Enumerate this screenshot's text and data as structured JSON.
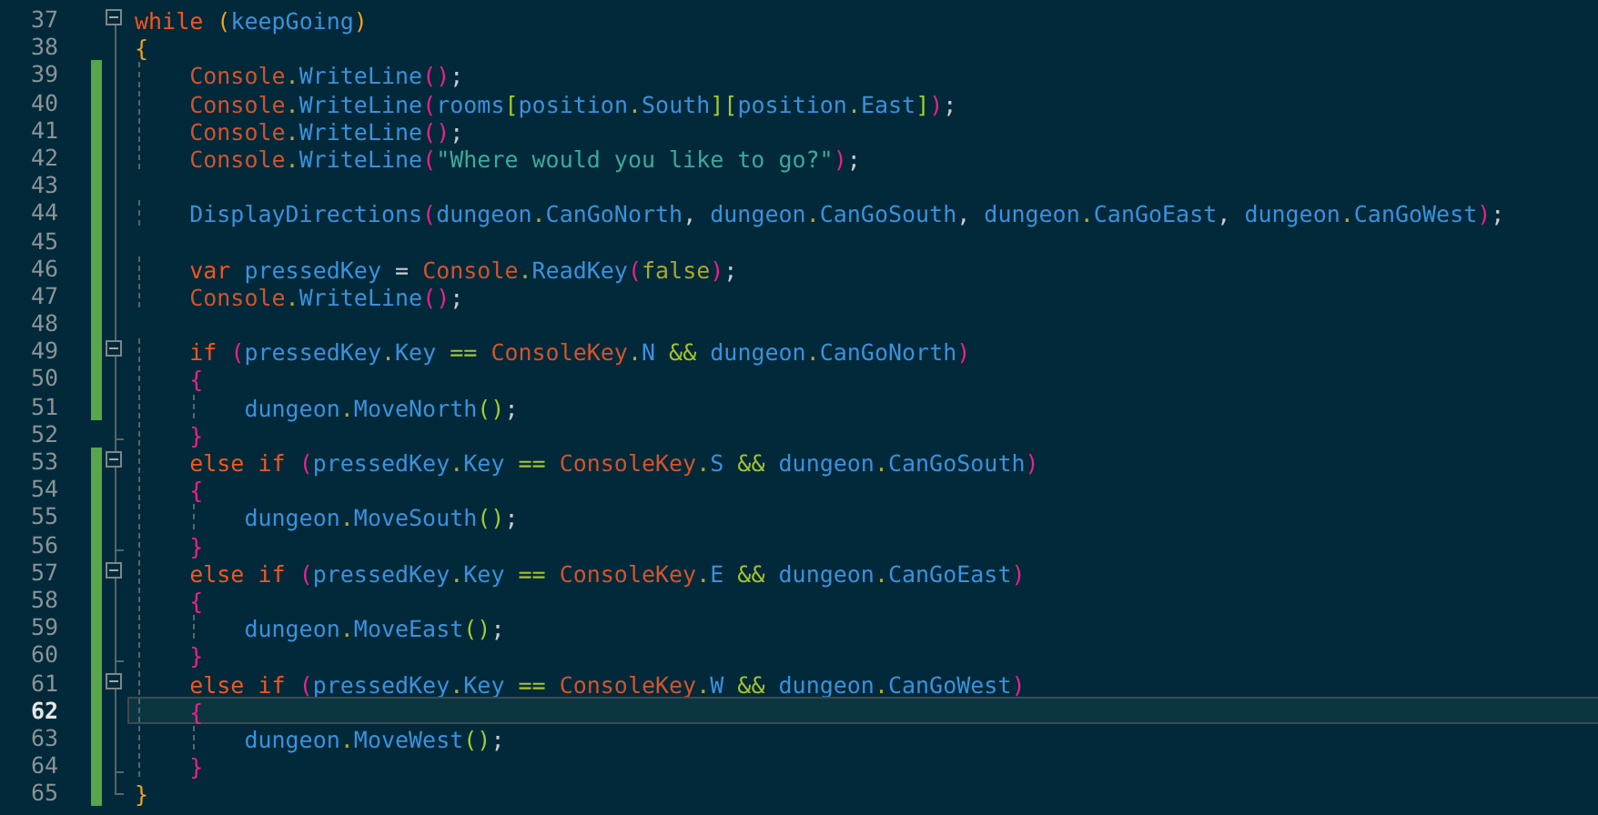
{
  "editor": {
    "lines": [
      {
        "number": "37",
        "changed": false,
        "current": false,
        "collapsible": true,
        "block_end": false,
        "tokens": [
          {
            "kind": "keyword",
            "text": "while "
          },
          {
            "kind": "brace-outer",
            "text": "("
          },
          {
            "kind": "name",
            "text": "keepGoing"
          },
          {
            "kind": "brace-outer",
            "text": ")"
          }
        ]
      },
      {
        "number": "38",
        "changed": false,
        "current": false,
        "collapsible": false,
        "block_end": false,
        "tokens": [
          {
            "kind": "brace-outer",
            "text": "{"
          }
        ]
      },
      {
        "number": "39",
        "changed": true,
        "current": false,
        "collapsible": false,
        "block_end": false,
        "tokens": [
          {
            "kind": "type",
            "text": "    Console"
          },
          {
            "kind": "dot",
            "text": "."
          },
          {
            "kind": "name",
            "text": "WriteLine"
          },
          {
            "kind": "brace-inner",
            "text": "()"
          },
          {
            "kind": "punct",
            "text": ";"
          }
        ]
      },
      {
        "number": "40",
        "changed": true,
        "current": false,
        "collapsible": false,
        "block_end": false,
        "tokens": [
          {
            "kind": "type",
            "text": "    Console"
          },
          {
            "kind": "dot",
            "text": "."
          },
          {
            "kind": "name",
            "text": "WriteLine"
          },
          {
            "kind": "brace-inner",
            "text": "("
          },
          {
            "kind": "name",
            "text": "rooms"
          },
          {
            "kind": "brace-nested",
            "text": "["
          },
          {
            "kind": "name",
            "text": "position"
          },
          {
            "kind": "dot",
            "text": "."
          },
          {
            "kind": "name",
            "text": "South"
          },
          {
            "kind": "brace-nested",
            "text": "]["
          },
          {
            "kind": "name",
            "text": "position"
          },
          {
            "kind": "dot",
            "text": "."
          },
          {
            "kind": "name",
            "text": "East"
          },
          {
            "kind": "brace-nested",
            "text": "]"
          },
          {
            "kind": "brace-inner",
            "text": ")"
          },
          {
            "kind": "punct",
            "text": ";"
          }
        ]
      },
      {
        "number": "41",
        "changed": true,
        "current": false,
        "collapsible": false,
        "block_end": false,
        "tokens": [
          {
            "kind": "type",
            "text": "    Console"
          },
          {
            "kind": "dot",
            "text": "."
          },
          {
            "kind": "name",
            "text": "WriteLine"
          },
          {
            "kind": "brace-inner",
            "text": "()"
          },
          {
            "kind": "punct",
            "text": ";"
          }
        ]
      },
      {
        "number": "42",
        "changed": true,
        "current": false,
        "collapsible": false,
        "block_end": false,
        "tokens": [
          {
            "kind": "type",
            "text": "    Console"
          },
          {
            "kind": "dot",
            "text": "."
          },
          {
            "kind": "name",
            "text": "WriteLine"
          },
          {
            "kind": "brace-inner",
            "text": "("
          },
          {
            "kind": "string",
            "text": "\"Where would you like to go?\""
          },
          {
            "kind": "brace-inner",
            "text": ")"
          },
          {
            "kind": "punct",
            "text": ";"
          }
        ]
      },
      {
        "number": "43",
        "changed": true,
        "current": false,
        "collapsible": false,
        "block_end": false
      },
      {
        "number": "44",
        "changed": true,
        "current": false,
        "collapsible": false,
        "block_end": false,
        "tokens": [
          {
            "kind": "name",
            "text": "    DisplayDirections"
          },
          {
            "kind": "brace-inner",
            "text": "("
          },
          {
            "kind": "name",
            "text": "dungeon"
          },
          {
            "kind": "dot",
            "text": "."
          },
          {
            "kind": "name",
            "text": "CanGoNorth"
          },
          {
            "kind": "punct",
            "text": ", "
          },
          {
            "kind": "name",
            "text": "dungeon"
          },
          {
            "kind": "dot",
            "text": "."
          },
          {
            "kind": "name",
            "text": "CanGoSouth"
          },
          {
            "kind": "punct",
            "text": ", "
          },
          {
            "kind": "name",
            "text": "dungeon"
          },
          {
            "kind": "dot",
            "text": "."
          },
          {
            "kind": "name",
            "text": "CanGoEast"
          },
          {
            "kind": "punct",
            "text": ", "
          },
          {
            "kind": "name",
            "text": "dungeon"
          },
          {
            "kind": "dot",
            "text": "."
          },
          {
            "kind": "name",
            "text": "CanGoWest"
          },
          {
            "kind": "brace-inner",
            "text": ")"
          },
          {
            "kind": "punct",
            "text": ";"
          }
        ]
      },
      {
        "number": "45",
        "changed": true,
        "current": false,
        "collapsible": false,
        "block_end": false
      },
      {
        "number": "46",
        "changed": true,
        "current": false,
        "collapsible": false,
        "block_end": false,
        "tokens": [
          {
            "kind": "keyword",
            "text": "    var"
          },
          {
            "kind": "name",
            "text": " pressedKey "
          },
          {
            "kind": "punct",
            "text": "= "
          },
          {
            "kind": "type",
            "text": "Console"
          },
          {
            "kind": "dot",
            "text": "."
          },
          {
            "kind": "name",
            "text": "ReadKey"
          },
          {
            "kind": "brace-inner",
            "text": "("
          },
          {
            "kind": "literal",
            "text": "false"
          },
          {
            "kind": "brace-inner",
            "text": ")"
          },
          {
            "kind": "punct",
            "text": ";"
          }
        ]
      },
      {
        "number": "47",
        "changed": true,
        "current": false,
        "collapsible": false,
        "block_end": false,
        "tokens": [
          {
            "kind": "type",
            "text": "    Console"
          },
          {
            "kind": "dot",
            "text": "."
          },
          {
            "kind": "name",
            "text": "WriteLine"
          },
          {
            "kind": "brace-inner",
            "text": "()"
          },
          {
            "kind": "punct",
            "text": ";"
          }
        ]
      },
      {
        "number": "48",
        "changed": true,
        "current": false,
        "collapsible": false,
        "block_end": false
      },
      {
        "number": "49",
        "changed": true,
        "current": false,
        "collapsible": true,
        "block_end": false,
        "tokens": [
          {
            "kind": "keyword",
            "text": "    if "
          },
          {
            "kind": "brace-inner",
            "text": "("
          },
          {
            "kind": "name",
            "text": "pressedKey"
          },
          {
            "kind": "dot",
            "text": "."
          },
          {
            "kind": "name",
            "text": "Key"
          },
          {
            "kind": "operator",
            "text": " == "
          },
          {
            "kind": "type",
            "text": "ConsoleKey"
          },
          {
            "kind": "dot",
            "text": "."
          },
          {
            "kind": "name",
            "text": "N"
          },
          {
            "kind": "operator",
            "text": " && "
          },
          {
            "kind": "name",
            "text": "dungeon"
          },
          {
            "kind": "dot",
            "text": "."
          },
          {
            "kind": "name",
            "text": "CanGoNorth"
          },
          {
            "kind": "brace-inner",
            "text": ")"
          }
        ]
      },
      {
        "number": "50",
        "changed": true,
        "current": false,
        "collapsible": false,
        "block_end": false,
        "tokens": [
          {
            "kind": "brace-inner",
            "text": "    {"
          }
        ]
      },
      {
        "number": "51",
        "changed": true,
        "current": false,
        "collapsible": false,
        "block_end": false,
        "tokens": [
          {
            "kind": "name",
            "text": "        dungeon"
          },
          {
            "kind": "dot",
            "text": "."
          },
          {
            "kind": "name",
            "text": "MoveNorth"
          },
          {
            "kind": "brace-nested",
            "text": "()"
          },
          {
            "kind": "punct",
            "text": ";"
          }
        ]
      },
      {
        "number": "52",
        "changed": false,
        "current": false,
        "collapsible": false,
        "block_end": true,
        "tokens": [
          {
            "kind": "brace-inner",
            "text": "    }"
          }
        ]
      },
      {
        "number": "53",
        "changed": true,
        "current": false,
        "collapsible": true,
        "block_end": false,
        "tokens": [
          {
            "kind": "keyword",
            "text": "    else if "
          },
          {
            "kind": "brace-inner",
            "text": "("
          },
          {
            "kind": "name",
            "text": "pressedKey"
          },
          {
            "kind": "dot",
            "text": "."
          },
          {
            "kind": "name",
            "text": "Key"
          },
          {
            "kind": "operator",
            "text": " == "
          },
          {
            "kind": "type",
            "text": "ConsoleKey"
          },
          {
            "kind": "dot",
            "text": "."
          },
          {
            "kind": "name",
            "text": "S"
          },
          {
            "kind": "operator",
            "text": " && "
          },
          {
            "kind": "name",
            "text": "dungeon"
          },
          {
            "kind": "dot",
            "text": "."
          },
          {
            "kind": "name",
            "text": "CanGoSouth"
          },
          {
            "kind": "brace-inner",
            "text": ")"
          }
        ]
      },
      {
        "number": "54",
        "changed": true,
        "current": false,
        "collapsible": false,
        "block_end": false,
        "tokens": [
          {
            "kind": "brace-inner",
            "text": "    {"
          }
        ]
      },
      {
        "number": "55",
        "changed": true,
        "current": false,
        "collapsible": false,
        "block_end": false,
        "tokens": [
          {
            "kind": "name",
            "text": "        dungeon"
          },
          {
            "kind": "dot",
            "text": "."
          },
          {
            "kind": "name",
            "text": "MoveSouth"
          },
          {
            "kind": "brace-nested",
            "text": "()"
          },
          {
            "kind": "punct",
            "text": ";"
          }
        ]
      },
      {
        "number": "56",
        "changed": true,
        "current": false,
        "collapsible": false,
        "block_end": true,
        "tokens": [
          {
            "kind": "brace-inner",
            "text": "    }"
          }
        ]
      },
      {
        "number": "57",
        "changed": true,
        "current": false,
        "collapsible": true,
        "block_end": false,
        "tokens": [
          {
            "kind": "keyword",
            "text": "    else if "
          },
          {
            "kind": "brace-inner",
            "text": "("
          },
          {
            "kind": "name",
            "text": "pressedKey"
          },
          {
            "kind": "dot",
            "text": "."
          },
          {
            "kind": "name",
            "text": "Key"
          },
          {
            "kind": "operator",
            "text": " == "
          },
          {
            "kind": "type",
            "text": "ConsoleKey"
          },
          {
            "kind": "dot",
            "text": "."
          },
          {
            "kind": "name",
            "text": "E"
          },
          {
            "kind": "operator",
            "text": " && "
          },
          {
            "kind": "name",
            "text": "dungeon"
          },
          {
            "kind": "dot",
            "text": "."
          },
          {
            "kind": "name",
            "text": "CanGoEast"
          },
          {
            "kind": "brace-inner",
            "text": ")"
          }
        ]
      },
      {
        "number": "58",
        "changed": true,
        "current": false,
        "collapsible": false,
        "block_end": false,
        "tokens": [
          {
            "kind": "brace-inner",
            "text": "    {"
          }
        ]
      },
      {
        "number": "59",
        "changed": true,
        "current": false,
        "collapsible": false,
        "block_end": false,
        "tokens": [
          {
            "kind": "name",
            "text": "        dungeon"
          },
          {
            "kind": "dot",
            "text": "."
          },
          {
            "kind": "name",
            "text": "MoveEast"
          },
          {
            "kind": "brace-nested",
            "text": "()"
          },
          {
            "kind": "punct",
            "text": ";"
          }
        ]
      },
      {
        "number": "60",
        "changed": true,
        "current": false,
        "collapsible": false,
        "block_end": true,
        "tokens": [
          {
            "kind": "brace-inner",
            "text": "    }"
          }
        ]
      },
      {
        "number": "61",
        "changed": true,
        "current": false,
        "collapsible": true,
        "block_end": false,
        "tokens": [
          {
            "kind": "keyword",
            "text": "    else if "
          },
          {
            "kind": "brace-inner",
            "text": "("
          },
          {
            "kind": "name",
            "text": "pressedKey"
          },
          {
            "kind": "dot",
            "text": "."
          },
          {
            "kind": "name",
            "text": "Key"
          },
          {
            "kind": "operator",
            "text": " == "
          },
          {
            "kind": "type",
            "text": "ConsoleKey"
          },
          {
            "kind": "dot",
            "text": "."
          },
          {
            "kind": "name",
            "text": "W"
          },
          {
            "kind": "operator",
            "text": " && "
          },
          {
            "kind": "name",
            "text": "dungeon"
          },
          {
            "kind": "dot",
            "text": "."
          },
          {
            "kind": "name",
            "text": "CanGoWest"
          },
          {
            "kind": "brace-inner",
            "text": ")"
          }
        ]
      },
      {
        "number": "62",
        "changed": true,
        "current": true,
        "collapsible": false,
        "block_end": false,
        "tokens": [
          {
            "kind": "brace-inner",
            "text": "    {"
          }
        ]
      },
      {
        "number": "63",
        "changed": true,
        "current": false,
        "collapsible": false,
        "block_end": false,
        "tokens": [
          {
            "kind": "name",
            "text": "        dungeon"
          },
          {
            "kind": "dot",
            "text": "."
          },
          {
            "kind": "name",
            "text": "MoveWest"
          },
          {
            "kind": "brace-nested",
            "text": "()"
          },
          {
            "kind": "punct",
            "text": ";"
          }
        ]
      },
      {
        "number": "64",
        "changed": true,
        "current": false,
        "collapsible": false,
        "block_end": true,
        "tokens": [
          {
            "kind": "brace-inner",
            "text": "    }"
          }
        ]
      },
      {
        "number": "65",
        "changed": true,
        "current": false,
        "collapsible": false,
        "block_end": true,
        "tokens": [
          {
            "kind": "brace-outer",
            "text": "}"
          }
        ]
      }
    ]
  }
}
